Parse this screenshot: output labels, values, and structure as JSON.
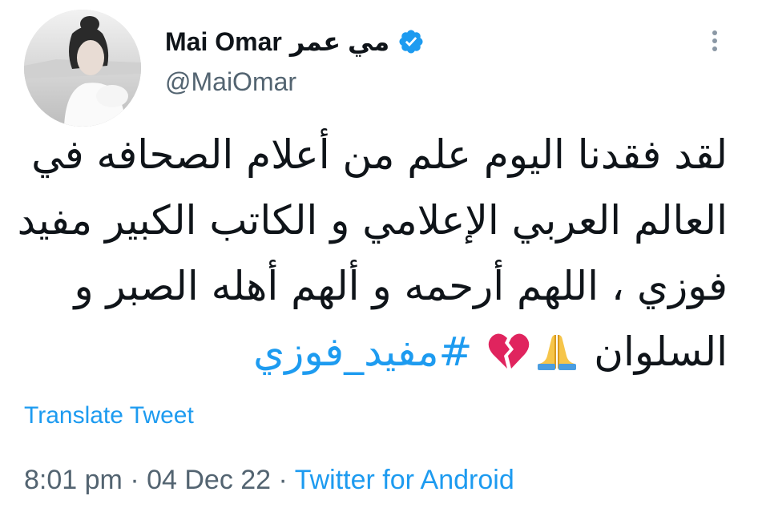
{
  "user": {
    "display_name": "Mai Omar",
    "display_name_arabic": "مي عمر",
    "handle": "@MaiOmar",
    "verified": true
  },
  "tweet": {
    "lines": [
      "لقد فقدنا اليوم علم من أعلام الصحافه في",
      "العالم العربي الإعلامي و الكاتب الكبير مفيد",
      "فوزي ، اللهم أرحمه و ألهم أهله الصبر و",
      "السلوان"
    ],
    "hashtag": "#مفيد_فوزي",
    "emojis": [
      "folded-hands",
      "broken-heart"
    ]
  },
  "translate_label": "Translate Tweet",
  "meta": {
    "time": "8:01 pm",
    "separator": "·",
    "date": "04 Dec 22",
    "source": "Twitter for Android"
  },
  "colors": {
    "accent": "#1d9bf0",
    "text": "#0f1419",
    "secondary": "#536471"
  }
}
